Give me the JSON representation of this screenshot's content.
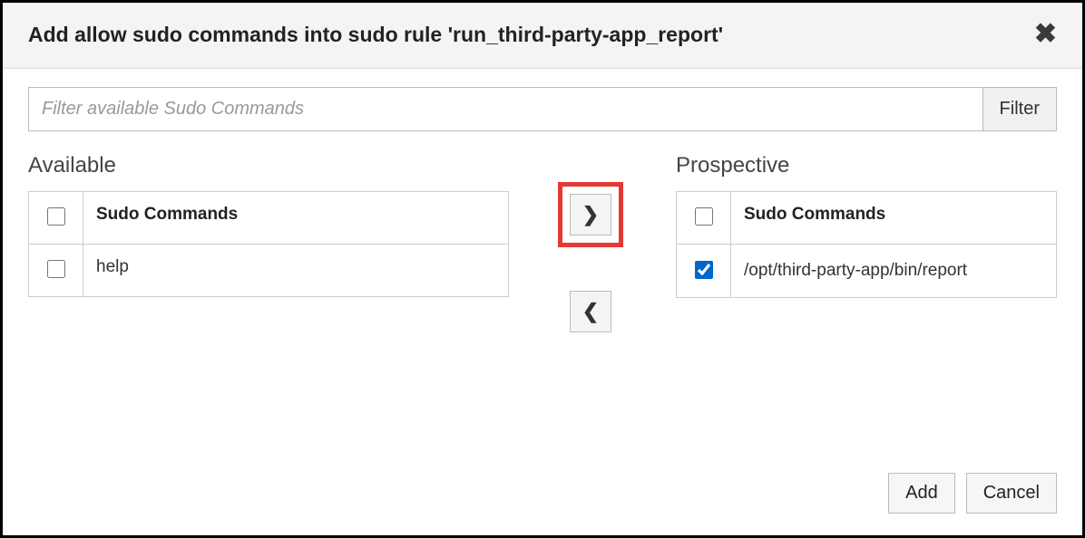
{
  "dialog": {
    "title": "Add allow sudo commands into sudo rule 'run_third-party-app_report'"
  },
  "filter": {
    "placeholder": "Filter available Sudo Commands",
    "button_label": "Filter",
    "value": ""
  },
  "available": {
    "title": "Available",
    "column_header": "Sudo Commands",
    "items": [
      {
        "label": "help",
        "checked": false
      }
    ]
  },
  "prospective": {
    "title": "Prospective",
    "column_header": "Sudo Commands",
    "items": [
      {
        "label": "/opt/third-party-app/bin/report",
        "checked": true
      }
    ]
  },
  "buttons": {
    "add": "Add",
    "cancel": "Cancel"
  },
  "icons": {
    "move_right": "❯",
    "move_left": "❮",
    "close": "✖"
  }
}
